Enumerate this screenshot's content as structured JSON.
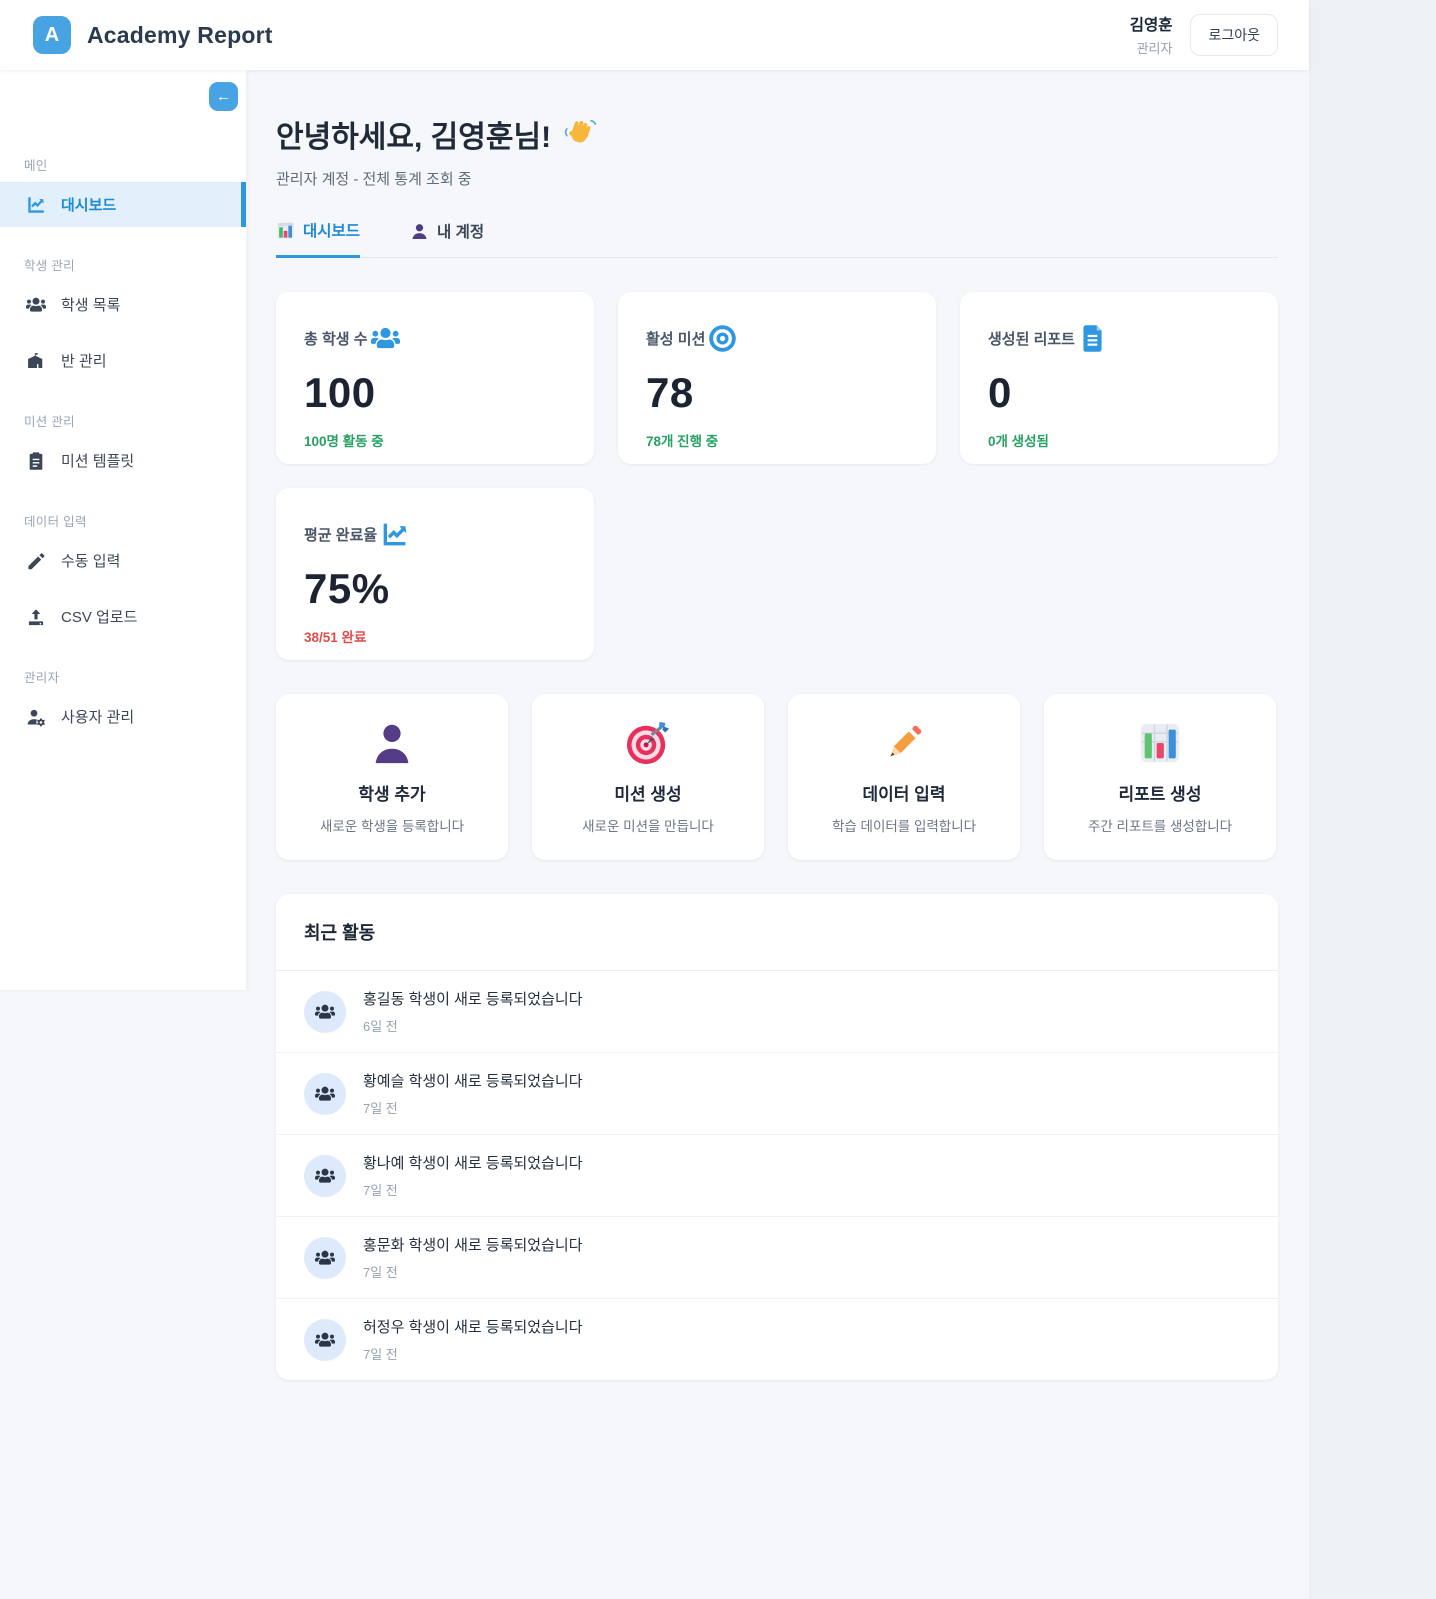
{
  "colors": {
    "brand_blue": "#47a3e2",
    "active_blue": "#1f8ad3",
    "green": "#27a163",
    "red": "#e14b4b",
    "page_bg": "#f5f7fa"
  },
  "header": {
    "logo_initial": "A",
    "app_title": "Academy Report",
    "user_name": "김영훈",
    "user_role": "관리자",
    "logout_label": "로그아웃"
  },
  "sidebar": {
    "collapse_icon": "←",
    "sections": [
      {
        "label": "메인",
        "items": [
          {
            "label": "대시보드",
            "icon": "chart-line-icon",
            "active": true
          }
        ]
      },
      {
        "label": "학생 관리",
        "items": [
          {
            "label": "학생 목록",
            "icon": "users-icon",
            "active": false
          },
          {
            "label": "반 관리",
            "icon": "school-icon",
            "active": false
          }
        ]
      },
      {
        "label": "미션 관리",
        "items": [
          {
            "label": "미션 템플릿",
            "icon": "clipboard-icon",
            "active": false
          }
        ]
      },
      {
        "label": "데이터 입력",
        "items": [
          {
            "label": "수동 입력",
            "icon": "pen-icon",
            "active": false
          },
          {
            "label": "CSV 업로드",
            "icon": "upload-icon",
            "active": false
          }
        ]
      },
      {
        "label": "관리자",
        "items": [
          {
            "label": "사용자 관리",
            "icon": "user-gear-icon",
            "active": false
          }
        ]
      }
    ]
  },
  "main": {
    "greeting": "안녕하세요, 김영훈님!",
    "greeting_emoji": "waving-hand-icon",
    "subtitle": "관리자 계정 - 전체 통계 조회 중",
    "tabs": [
      {
        "label": "대시보드",
        "icon": "bar-chart-icon",
        "active": true
      },
      {
        "label": "내 계정",
        "icon": "person-icon",
        "active": false
      }
    ],
    "stats": [
      {
        "label": "총 학생 수",
        "icon": "users-icon",
        "value": "100",
        "sub": "100명 활동 중",
        "sub_color": "green"
      },
      {
        "label": "활성 미션",
        "icon": "target-icon",
        "value": "78",
        "sub": "78개 진행 중",
        "sub_color": "green"
      },
      {
        "label": "생성된 리포트",
        "icon": "document-icon",
        "value": "0",
        "sub": "0개 생성됨",
        "sub_color": "green"
      },
      {
        "label": "평균 완료율",
        "icon": "trend-icon",
        "value": "75%",
        "sub": "38/51 완료",
        "sub_color": "red"
      }
    ],
    "actions": [
      {
        "title": "학생 추가",
        "desc": "새로운 학생을 등록합니다",
        "icon": "person-emoji-icon"
      },
      {
        "title": "미션 생성",
        "desc": "새로운 미션을 만듭니다",
        "icon": "dart-emoji-icon"
      },
      {
        "title": "데이터 입력",
        "desc": "학습 데이터를 입력합니다",
        "icon": "pencil-emoji-icon"
      },
      {
        "title": "리포트 생성",
        "desc": "주간 리포트를 생성합니다",
        "icon": "bar-chart-emoji-icon"
      }
    ],
    "activity": {
      "title": "최근 활동",
      "items": [
        {
          "text": "홍길동 학생이 새로 등록되었습니다",
          "time": "6일 전"
        },
        {
          "text": "황예슬 학생이 새로 등록되었습니다",
          "time": "7일 전"
        },
        {
          "text": "황나예 학생이 새로 등록되었습니다",
          "time": "7일 전"
        },
        {
          "text": "홍문화 학생이 새로 등록되었습니다",
          "time": "7일 전"
        },
        {
          "text": "허정우 학생이 새로 등록되었습니다",
          "time": "7일 전"
        }
      ]
    }
  }
}
